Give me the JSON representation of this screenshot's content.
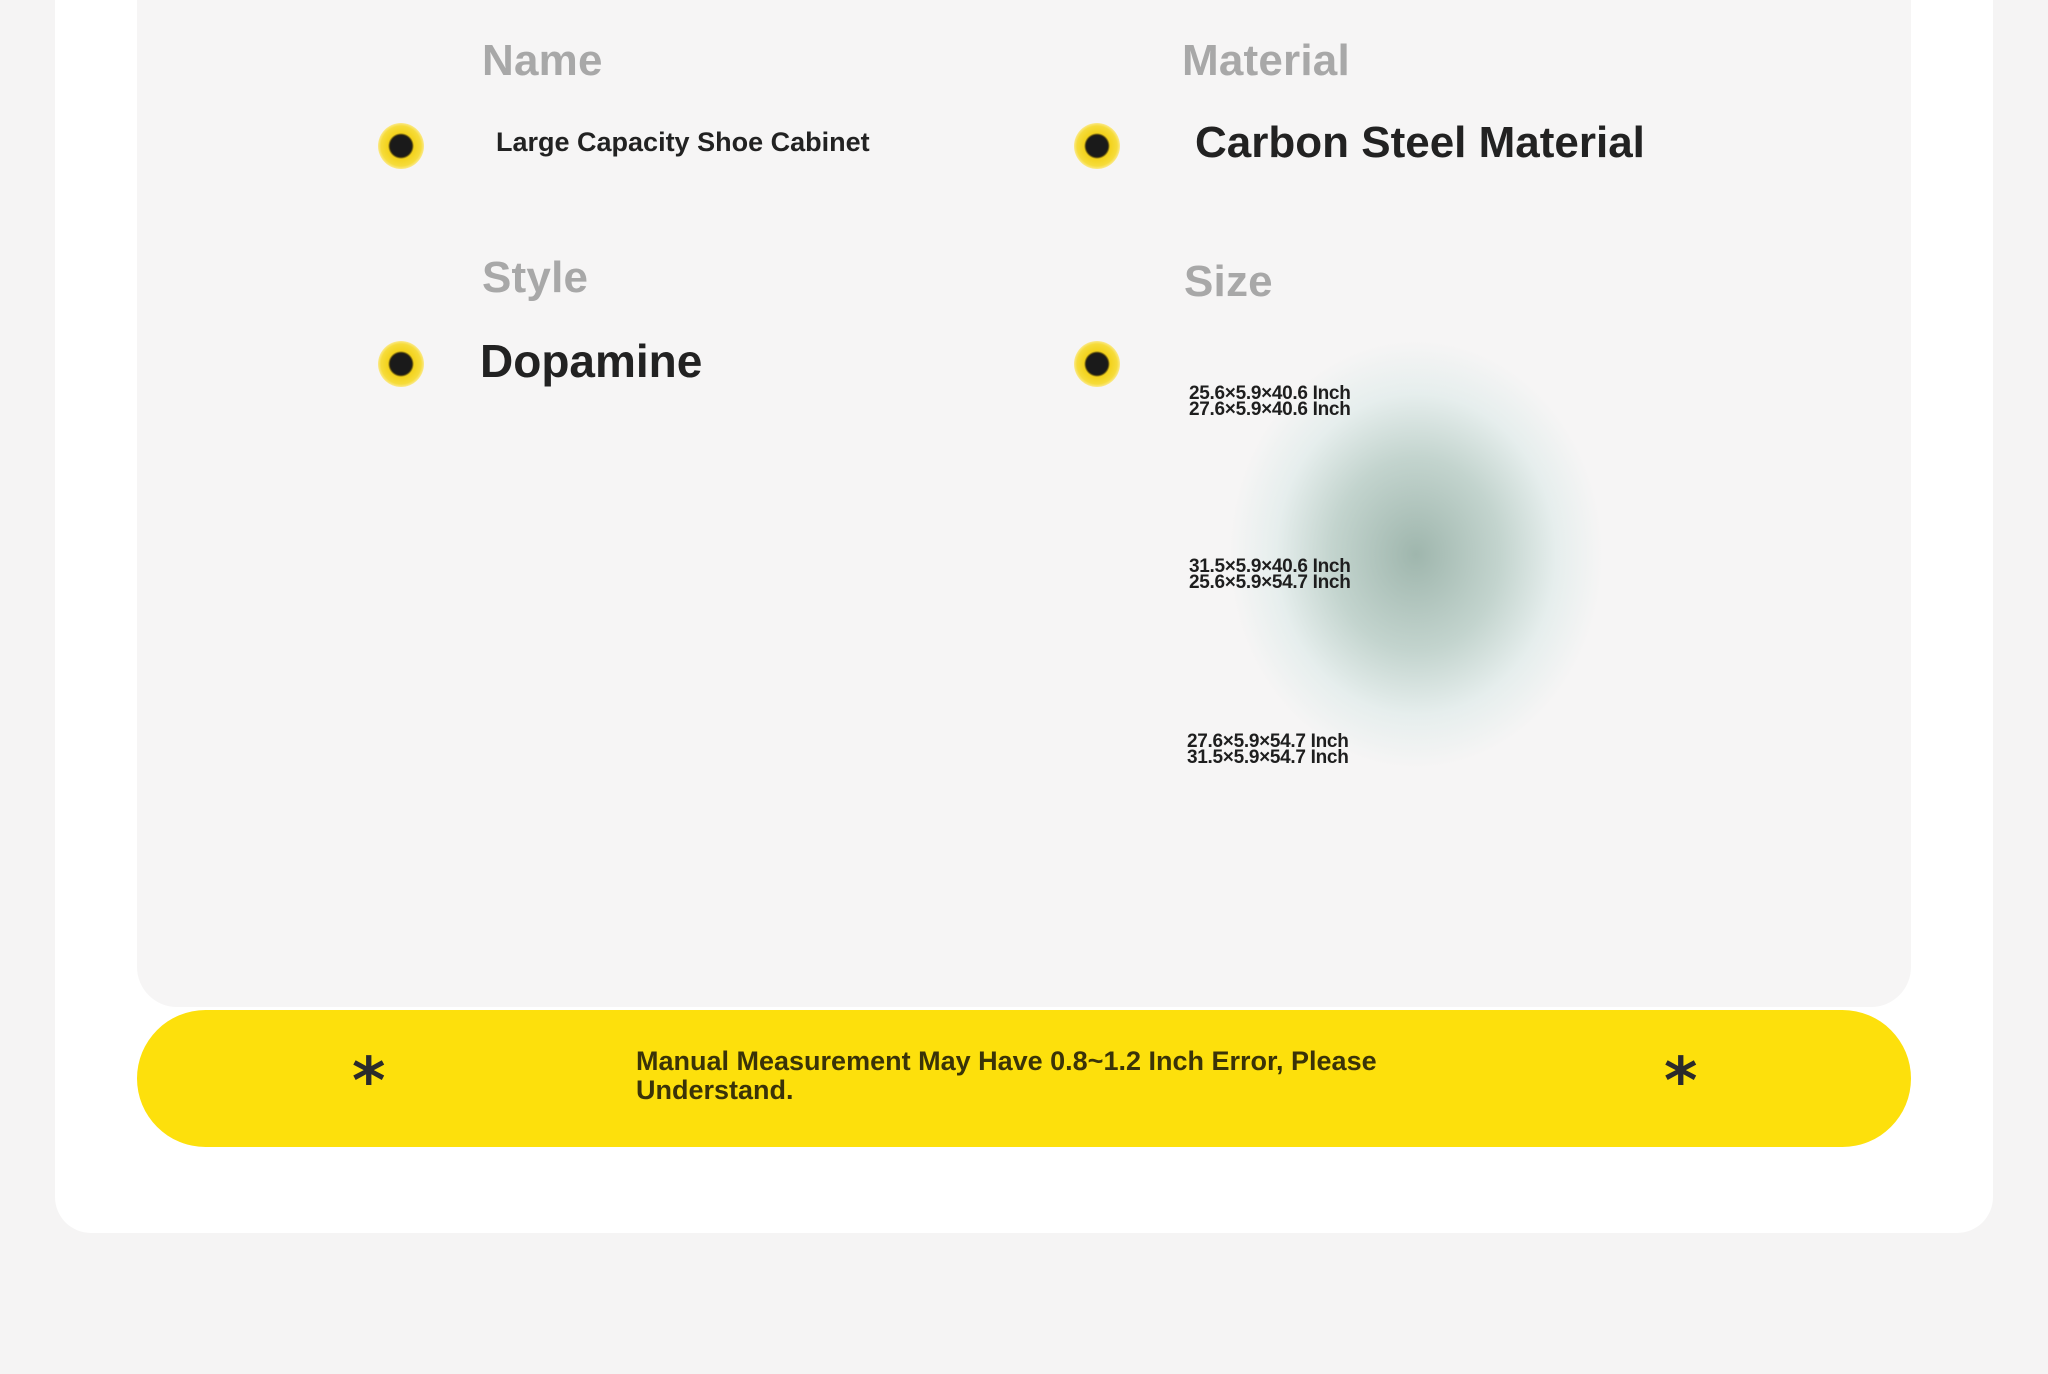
{
  "specs": {
    "name": {
      "label": "Name",
      "value": "Large Capacity Shoe Cabinet"
    },
    "material": {
      "label": "Material",
      "value": "Carbon Steel Material"
    },
    "style": {
      "label": "Style",
      "value": "Dopamine"
    },
    "size": {
      "label": "Size",
      "values": [
        "25.6×5.9×40.6 Inch",
        "27.6×5.9×40.6 Inch",
        "31.5×5.9×40.6 Inch",
        "25.6×5.9×54.7 Inch",
        "27.6×5.9×54.7 Inch",
        "31.5×5.9×54.7 Inch"
      ]
    }
  },
  "notice": {
    "left_symbol": "*",
    "text": "Manual Measurement May Have 0.8~1.2 Inch Error, Please Understand.",
    "right_symbol": "*"
  },
  "colors": {
    "accent": "#fde00c",
    "label": "#a8a8a8",
    "value": "#222222",
    "panel": "#f6f5f5"
  },
  "icons": {
    "bullet": "bullet-dot-icon",
    "notice": "asterisk-icon"
  }
}
